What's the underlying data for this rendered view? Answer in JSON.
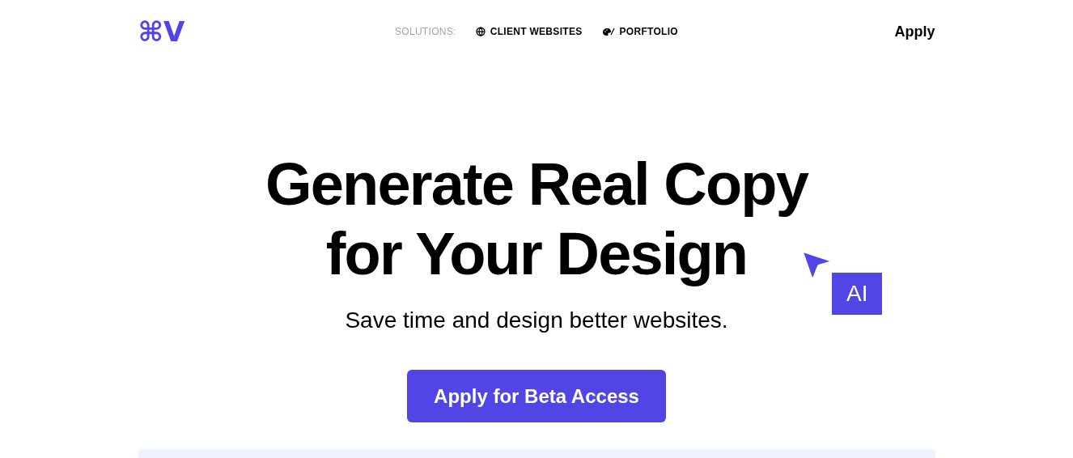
{
  "nav": {
    "logo": "⌘V",
    "solutions_label": "SOLUTIONS:",
    "links": [
      {
        "kind": "globe",
        "label": "CLIENT WEBSITES"
      },
      {
        "kind": "palette",
        "label": "PORFTOLIO"
      }
    ],
    "apply": "Apply"
  },
  "hero": {
    "title_lines": [
      "Generate Real Copy",
      "for Your Design"
    ],
    "cursor_badge": "AI",
    "subtitle": "Save time and design better websites.",
    "cta": "Apply for Beta Access"
  }
}
